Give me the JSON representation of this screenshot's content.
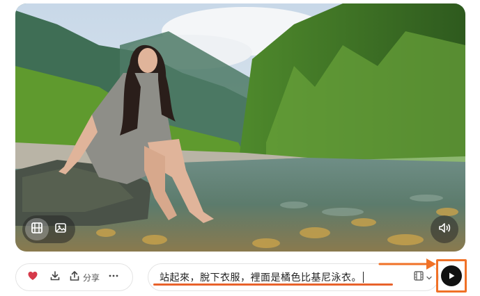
{
  "media": {
    "icons": {
      "video": "film-icon",
      "image": "image-icon",
      "sound": "speaker-icon"
    },
    "active_mode": "video"
  },
  "actions": {
    "like_icon": "heart-icon",
    "download_icon": "download-icon",
    "share_label": "分享",
    "more_icon": "more-horizontal-icon"
  },
  "prompt": {
    "text": "站起來，脫下衣服，裡面是橘色比基尼泳衣。"
  },
  "model_picker": {
    "icon": "film-strip-icon",
    "chevron": "chevron-down-icon"
  },
  "send": {
    "icon": "play-icon"
  },
  "colors": {
    "accent": "#f07127",
    "heart": "#d63a4a",
    "send_bg": "#111111"
  }
}
